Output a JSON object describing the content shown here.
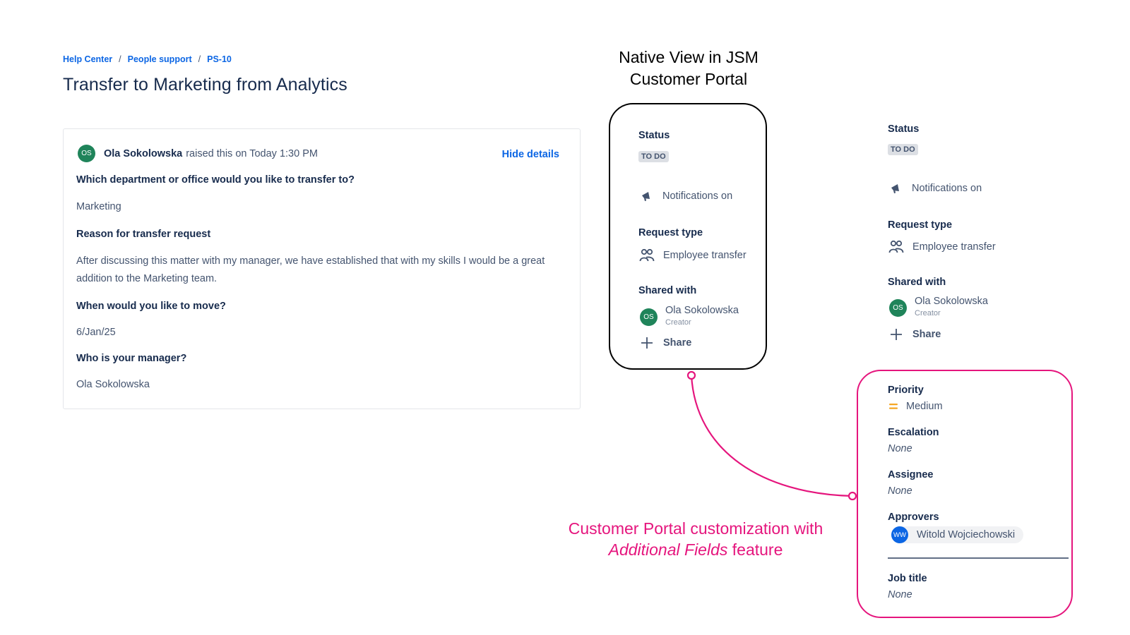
{
  "breadcrumb": [
    "Help Center",
    "People support",
    "PS-10"
  ],
  "page_title": "Transfer to Marketing from Analytics",
  "request": {
    "avatar_initials": "OS",
    "author": "Ola Sokolowska",
    "raised_text": "raised this on Today 1:30 PM",
    "hide_details": "Hide details",
    "fields": [
      {
        "question": "Which department or office would you like to transfer to?",
        "answer": "Marketing"
      },
      {
        "question": "Reason for transfer request",
        "answer": "After discussing this matter with my manager, we have established that with my skills I would be a great addition to the Marketing team."
      },
      {
        "question": "When would you like to move?",
        "answer": "6/Jan/25"
      },
      {
        "question": "Who is your manager?",
        "answer": "Ola Sokolowska"
      }
    ]
  },
  "annotations": {
    "native_title": "Native View in JSM Customer Portal",
    "custom_caption_prefix": "Customer Portal customization with ",
    "custom_caption_em": "Additional Fields",
    "custom_caption_suffix": " feature",
    "accent_color": "#e5157d"
  },
  "sidebar": {
    "status_label": "Status",
    "status_value": "TO DO",
    "notifications": "Notifications on",
    "request_type_label": "Request type",
    "request_type_value": "Employee transfer",
    "shared_with_label": "Shared with",
    "shared_avatar": "OS",
    "shared_name": "Ola Sokolowska",
    "shared_role": "Creator",
    "share_label": "Share"
  },
  "additional_fields": {
    "priority_label": "Priority",
    "priority_value": "Medium",
    "escalation_label": "Escalation",
    "escalation_value": "None",
    "assignee_label": "Assignee",
    "assignee_value": "None",
    "approvers_label": "Approvers",
    "approver_initials": "WW",
    "approver_name": "Witold Wojciechowski",
    "job_title_label": "Job title",
    "job_title_value": "None"
  },
  "icons": {
    "notifications": "megaphone-icon",
    "request_type": "people-icon",
    "share": "plus-icon",
    "priority": "priority-medium-icon"
  }
}
